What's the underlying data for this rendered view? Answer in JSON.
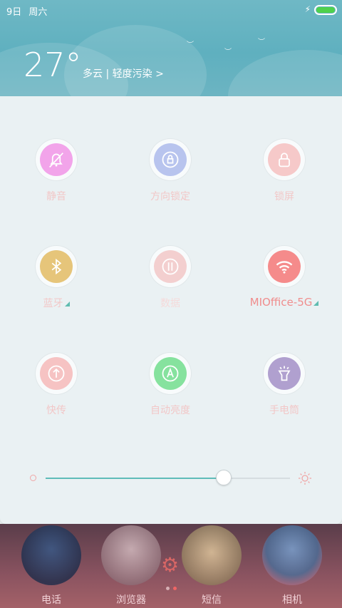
{
  "status_bar": {
    "date": "9日",
    "weekday": "周六",
    "charging_icon": "lightning-icon",
    "battery_icon": "battery-icon",
    "battery_color": "#4fd14c"
  },
  "weather": {
    "temperature": "27°",
    "summary": "多云 | 轻度污染 >"
  },
  "toggles": [
    {
      "label": "静音",
      "icon": "bell-off-icon",
      "color": "#f2a4ea"
    },
    {
      "label": "方向锁定",
      "icon": "rotation-lock-icon",
      "color": "#b8c4ee"
    },
    {
      "label": "锁屏",
      "icon": "lock-icon",
      "color": "#f6c9c9"
    },
    {
      "label": "蓝牙",
      "icon": "bluetooth-icon",
      "color": "#e6c57a"
    },
    {
      "label": "数据",
      "icon": "mobile-data-icon",
      "color": "#f3cfcf"
    },
    {
      "label": "MIOffice-5G",
      "icon": "wifi-icon",
      "color": "#f58b8b"
    },
    {
      "label": "快传",
      "icon": "upload-icon",
      "color": "#f6c3c3"
    },
    {
      "label": "自动亮度",
      "icon": "auto-brightness-icon",
      "color": "#86e29e"
    },
    {
      "label": "手电筒",
      "icon": "flashlight-icon",
      "color": "#b0a0cf"
    }
  ],
  "brightness": {
    "level": 0.73,
    "min_icon": "brightness-low-icon",
    "max_icon": "brightness-high-icon"
  },
  "dock": {
    "apps": [
      {
        "label": "电话",
        "icon": "phone-app-icon"
      },
      {
        "label": "浏览器",
        "icon": "browser-app-icon"
      },
      {
        "label": "短信",
        "icon": "messages-app-icon"
      },
      {
        "label": "相机",
        "icon": "camera-app-icon"
      }
    ],
    "settings_icon": "gear-icon"
  }
}
